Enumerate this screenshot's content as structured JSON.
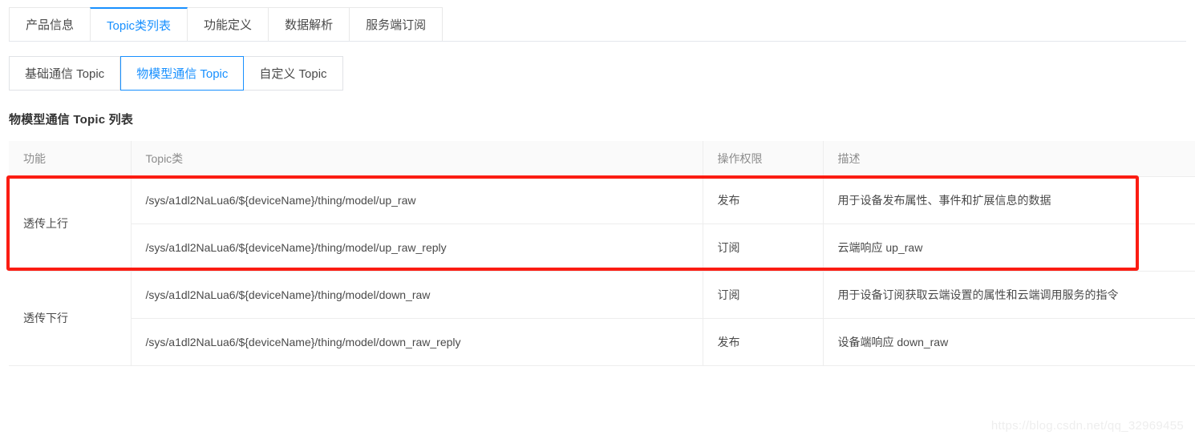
{
  "primary_tabs": [
    {
      "label": "产品信息",
      "active": false
    },
    {
      "label": "Topic类列表",
      "active": true
    },
    {
      "label": "功能定义",
      "active": false
    },
    {
      "label": "数据解析",
      "active": false
    },
    {
      "label": "服务端订阅",
      "active": false
    }
  ],
  "secondary_tabs": [
    {
      "label": "基础通信 Topic",
      "active": false
    },
    {
      "label": "物模型通信 Topic",
      "active": true
    },
    {
      "label": "自定义 Topic",
      "active": false
    }
  ],
  "section": {
    "title": "物模型通信 Topic 列表"
  },
  "table": {
    "columns": [
      "功能",
      "Topic类",
      "操作权限",
      "描述"
    ],
    "rows": [
      {
        "function": "透传上行",
        "topic": "/sys/a1dl2NaLua6/${deviceName}/thing/model/up_raw",
        "permission": "发布",
        "description": "用于设备发布属性、事件和扩展信息的数据",
        "rowspan": 2,
        "highlighted": true
      },
      {
        "function": "",
        "topic": "/sys/a1dl2NaLua6/${deviceName}/thing/model/up_raw_reply",
        "permission": "订阅",
        "description": "云端响应 up_raw",
        "rowspan": 0,
        "highlighted": true
      },
      {
        "function": "透传下行",
        "topic": "/sys/a1dl2NaLua6/${deviceName}/thing/model/down_raw",
        "permission": "订阅",
        "description": "用于设备订阅获取云端设置的属性和云端调用服务的指令",
        "rowspan": 2,
        "highlighted": false
      },
      {
        "function": "",
        "topic": "/sys/a1dl2NaLua6/${deviceName}/thing/model/down_raw_reply",
        "permission": "发布",
        "description": "设备端响应 down_raw",
        "rowspan": 0,
        "highlighted": false
      }
    ]
  },
  "annotation": {
    "highlight_color": "#fb1c12"
  },
  "watermark": {
    "text": "https://blog.csdn.net/qq_32969455"
  },
  "colors": {
    "accent": "#1890ff",
    "text": "#4a4a4a",
    "muted": "#8c8c8c",
    "border": "#ededed",
    "header_bg": "#fafafa"
  }
}
